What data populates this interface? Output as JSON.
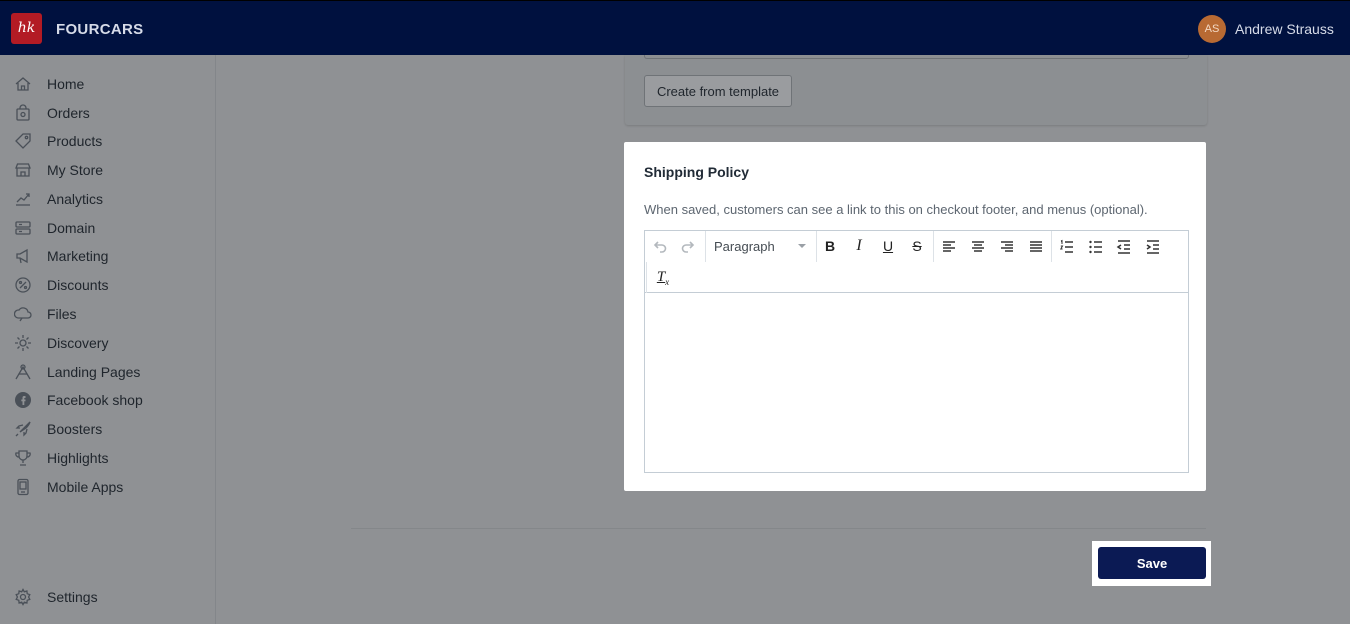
{
  "header": {
    "brand": "FOURCARS",
    "logo_text": "hk",
    "user_initials": "AS",
    "user_name": "Andrew Strauss"
  },
  "sidebar": {
    "items": [
      {
        "label": "Home",
        "icon": "home-icon"
      },
      {
        "label": "Orders",
        "icon": "orders-icon"
      },
      {
        "label": "Products",
        "icon": "tag-icon"
      },
      {
        "label": "My Store",
        "icon": "store-icon"
      },
      {
        "label": "Analytics",
        "icon": "analytics-icon"
      },
      {
        "label": "Domain",
        "icon": "domain-icon"
      },
      {
        "label": "Marketing",
        "icon": "marketing-icon"
      },
      {
        "label": "Discounts",
        "icon": "discount-icon"
      },
      {
        "label": "Files",
        "icon": "files-icon"
      },
      {
        "label": "Discovery",
        "icon": "discovery-icon"
      },
      {
        "label": "Landing Pages",
        "icon": "landing-pages-icon"
      },
      {
        "label": "Facebook shop",
        "icon": "facebook-icon"
      },
      {
        "label": "Boosters",
        "icon": "rocket-icon"
      },
      {
        "label": "Highlights",
        "icon": "trophy-icon"
      },
      {
        "label": "Mobile Apps",
        "icon": "mobile-icon"
      }
    ],
    "settings_label": "Settings"
  },
  "main": {
    "template_button": "Create from template",
    "shipping_card": {
      "title": "Shipping Policy",
      "description": "When saved, customers can see a link to this on checkout footer, and menus (optional).",
      "editor": {
        "format_select": "Paragraph",
        "content": ""
      }
    },
    "save_label": "Save"
  },
  "colors": {
    "topbar": "#00113f",
    "save_button": "#0b1a54",
    "logo": "#b31b24",
    "avatar": "#b86a33"
  }
}
